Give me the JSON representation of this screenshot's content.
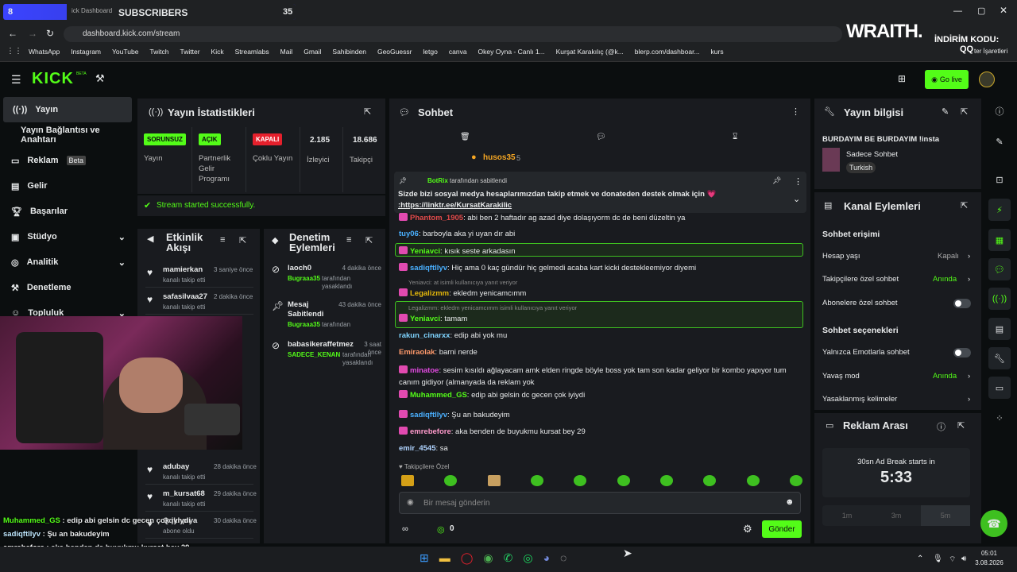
{
  "widget": {
    "count": "8",
    "label": "SUBSCRIBERS",
    "goal": "35"
  },
  "browser": {
    "tab_frag": "ick Dashboard",
    "url": "dashboard.kick.com/stream",
    "bookmarks": [
      "WhatsApp",
      "Instagram",
      "YouTube",
      "Twitch",
      "Twitter",
      "Kick",
      "Streamlabs",
      "Mail",
      "Gmail",
      "Sahibinden",
      "GeoGuessr",
      "letgo",
      "canva",
      "Okey Oyna - Canlı 1...",
      "Kurşat Karakılıç (@k...",
      "blerp.com/dashboar...",
      "kurs"
    ],
    "other_bookmarks": "ter İşaretleri"
  },
  "overlay": {
    "brand": "WRAITH.",
    "discount": "İNDİRİM KODU:",
    "code": "QQ"
  },
  "header": {
    "logo": "KICK",
    "beta": "BETA",
    "go_live": "Go live"
  },
  "nav": {
    "items": [
      {
        "label": "Yayın"
      },
      {
        "label": "Yayın Bağlantısı ve Anahtarı"
      },
      {
        "label": "Reklam",
        "tag": "Beta"
      },
      {
        "label": "Gelir"
      },
      {
        "label": "Başarılar"
      },
      {
        "label": "Stüdyo"
      },
      {
        "label": "Analitik"
      },
      {
        "label": "Denetleme"
      },
      {
        "label": "Topluluk"
      }
    ]
  },
  "stats": {
    "title": "Yayın İstatistikleri",
    "badges": [
      {
        "badge": "SORUNSUZ",
        "label": "Yayın",
        "color": "#53fc18"
      },
      {
        "badge": "AÇIK",
        "label": "Partnerlik Gelir Programı",
        "color": "#53fc18"
      },
      {
        "badge": "KAPALI",
        "label": "Çoklu Yayın",
        "color": "#e5202c"
      },
      {
        "badge": "2.185",
        "label": "İzleyici",
        "color": ""
      },
      {
        "badge": "18.686",
        "label": "Takipçi",
        "color": ""
      }
    ],
    "success": "Stream started successfully."
  },
  "activity": {
    "title": "Etkinlik Akışı",
    "items": [
      {
        "name": "mamierkan",
        "time": "3 saniye önce",
        "sub": "kanalı takip etti"
      },
      {
        "name": "safasilvaa27",
        "time": "2 dakika önce",
        "sub": "kanalı takip etti"
      },
      {
        "name": "adubay",
        "time": "28 dakika önce",
        "sub": "kanalı takip etti"
      },
      {
        "name": "m_kursat68",
        "time": "29 dakika önce",
        "sub": "kanalı takip etti"
      },
      {
        "name": "Qqkhpiya",
        "time": "30 dakika önce",
        "sub": "abone oldu"
      }
    ]
  },
  "moderation": {
    "title": "Denetim Eylemleri",
    "items": [
      {
        "name": "laoch0",
        "time": "4 dakika önce",
        "by": "Bugraaa35",
        "sub": "tarafından yasaklandı"
      },
      {
        "name": "Mesaj Sabitlendi",
        "time": "43 dakika önce",
        "by": "Bugraaa35",
        "sub": "tarafından"
      },
      {
        "name": "babasikeraffetmez",
        "time": "3 saat önce",
        "by": "SADECE_KENAN",
        "sub": "tarafından yasaklandı"
      }
    ]
  },
  "chat": {
    "title": "Sohbet",
    "top_user": "husos35",
    "top_count": "5",
    "pinned_by": "BotRix",
    "pinned_by_suffix": "tarafından sabitlendi",
    "pinned_text": "Sizde bizi sosyal medya hesaplarımızdan takip etmek ve donateden destek olmak için 💗",
    "pinned_link": ":https://linktr.ee/KursatKarakilic",
    "messages": [
      {
        "user": "Phantom_1905",
        "color": "#e14a4a",
        "text": "abi ben 2 haftadır ag azad diye dolaşıyorm dc de beni düzeltin ya"
      },
      {
        "user": "tuy06",
        "color": "#4ab0ff",
        "text": "barboyla aka yi uyan dır abi"
      },
      {
        "user": "Yeniavci",
        "color": "#53fc18",
        "text": "kısık seste arkadasın"
      },
      {
        "user": "sadiqftllyv",
        "color": "#4ab0ff",
        "text": "Hiç ama 0 kaç gündür hiç gelmedi acaba kart kicki destekleemiyor diyemi"
      },
      {
        "user": "Legalizmm",
        "color": "#e5b80b",
        "text": "ekledm yenicamcımm",
        "reply": "Yeniavci: at isimli kullanıcıya yanıt veriyor"
      },
      {
        "user": "Yeniavci",
        "color": "#53fc18",
        "text": "tamam",
        "reply": "Legalizmm: ekledm yenicamcımm isimli kullanıcıya yanıt veriyor"
      },
      {
        "user": "rakun_cinarxx",
        "color": "#7fd4ff",
        "text": "edip abi yok mu"
      },
      {
        "user": "Emiraolak",
        "color": "#ff9a6b",
        "text": "barni nerde"
      },
      {
        "user": "minatoe",
        "color": "#e14ae0",
        "text": "sesim kısıldı ağlayacam amk elden ringde böyle boss yok tam son kadar geliyor bir kombo yapıyor tum canım gidiyor (almanyada da reklam yok"
      },
      {
        "user": "Muhammed_GS",
        "color": "#53fc18",
        "text": "edip abi gelsin dc gecen çok iyiydi"
      },
      {
        "user": "sadiqftllyv",
        "color": "#4ab0ff",
        "text": "Şu an bakudeyim"
      },
      {
        "user": "emrebefore",
        "color": "#ff9acb",
        "text": "aka benden de buyukmu kursat bey 29"
      },
      {
        "user": "emir_4545",
        "color": "#b0d4ff",
        "text": "sa"
      }
    ],
    "followers_only": "Takipçilere Özel",
    "placeholder": "Bir mesaj gönderin",
    "points": "0",
    "send": "Gönder"
  },
  "info": {
    "title": "Yayın bilgisi",
    "stream_title": "BURDAYIM BE BURDAYIM !insta",
    "category": "Sadece Sohbet",
    "tag": "Turkish"
  },
  "channel": {
    "title": "Kanal Eylemleri",
    "access_title": "Sohbet erişimi",
    "account_age": "Hesap yaşı",
    "account_age_val": "Kapalı",
    "followers_chat": "Takipçilere özel sohbet",
    "followers_chat_val": "Anında",
    "subs_chat": "Abonelere özel sohbet",
    "options_title": "Sohbet seçenekleri",
    "emote_only": "Yalnızca Emotlarla sohbet",
    "slow": "Yavaş mod",
    "slow_val": "Anında",
    "banned": "Yasaklanmış kelimeler"
  },
  "ads": {
    "title": "Reklam Arası",
    "starts": "30sn Ad Break starts in",
    "timer": "5:33",
    "opts": [
      "1m",
      "3m",
      "5m"
    ]
  },
  "overlay_chat": [
    {
      "user": "Muhammed_GS",
      "text": "edip abi gelsin dc gecen çok iyiydi"
    },
    {
      "user": "sadiqftllyv",
      "text": "Şu an bakudeyim"
    },
    {
      "user": "emrebefore",
      "text": "aka benden de buyukmu kursat bey 29"
    },
    {
      "user": "emir_4545",
      "text": "sa"
    }
  ],
  "taskbar": {
    "time": "05:01",
    "date": "3.08.2026"
  }
}
